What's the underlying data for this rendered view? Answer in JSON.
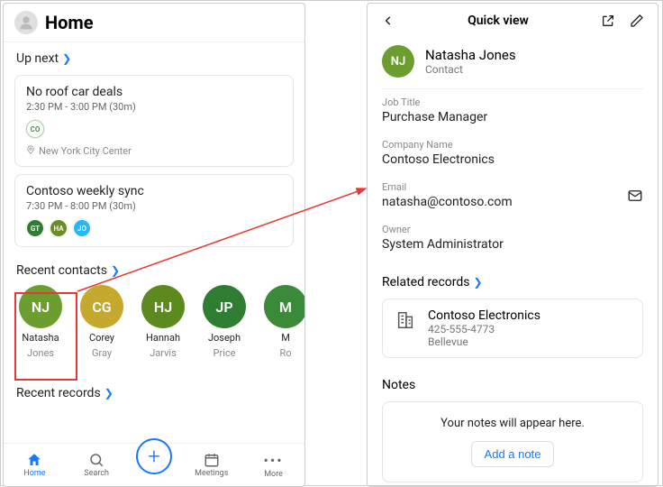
{
  "home": {
    "title": "Home",
    "up_next_label": "Up next",
    "events": [
      {
        "title": "No roof car deals",
        "time": "2:30 PM - 3:00 PM (30m)",
        "attendees": [
          {
            "initials": "CO",
            "color_class": "outline"
          }
        ],
        "location": "New York City Center"
      },
      {
        "title": "Contoso weekly sync",
        "time": "7:30 PM - 8:00 PM (30m)",
        "attendees": [
          {
            "initials": "GT",
            "color": "#2e7d32"
          },
          {
            "initials": "HA",
            "color": "#6b8e23"
          },
          {
            "initials": "JO",
            "color": "#29b6f6"
          }
        ]
      }
    ],
    "recent_contacts_label": "Recent contacts",
    "contacts": [
      {
        "initials": "NJ",
        "first": "Natasha",
        "last": "Jones",
        "color": "#6b9e2f"
      },
      {
        "initials": "CG",
        "first": "Corey",
        "last": "Gray",
        "color": "#c5a82e"
      },
      {
        "initials": "HJ",
        "first": "Hannah",
        "last": "Jarvis",
        "color": "#5c8a1f"
      },
      {
        "initials": "JP",
        "first": "Joseph",
        "last": "Price",
        "color": "#2e7d32"
      },
      {
        "initials": "M",
        "first": "M",
        "last": "Ro",
        "color": "#3a8a3a"
      }
    ],
    "recent_records_label": "Recent records",
    "nav": {
      "home": "Home",
      "search": "Search",
      "meetings": "Meetings",
      "more": "More"
    }
  },
  "quick": {
    "title": "Quick view",
    "avatar_initials": "NJ",
    "avatar_color": "#6b9e2f",
    "name": "Natasha Jones",
    "type": "Contact",
    "fields": {
      "job_label": "Job Title",
      "job_value": "Purchase Manager",
      "company_label": "Company Name",
      "company_value": "Contoso Electronics",
      "email_label": "Email",
      "email_value": "natasha@contoso.com",
      "owner_label": "Owner",
      "owner_value": "System Administrator"
    },
    "related_label": "Related records",
    "record": {
      "name": "Contoso Electronics",
      "phone": "425-555-4773",
      "city": "Bellevue"
    },
    "notes_label": "Notes",
    "notes_empty": "Your notes will appear here.",
    "add_note": "Add a note"
  }
}
